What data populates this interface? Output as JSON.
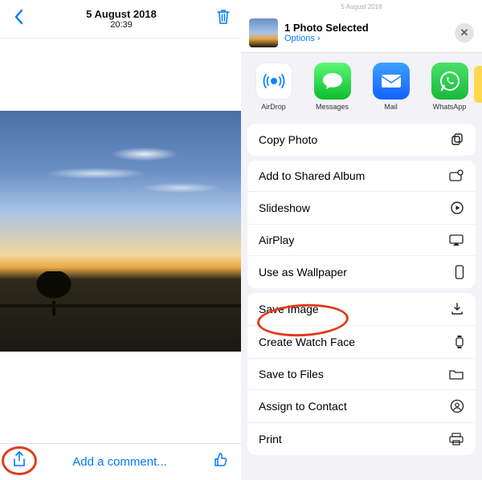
{
  "left": {
    "date": "5 August 2018",
    "time": "20:39",
    "comment_placeholder": "Add a comment..."
  },
  "right": {
    "bg_date": "5 August 2018",
    "header_title": "1 Photo Selected",
    "header_options": "Options",
    "apps": [
      {
        "label": "AirDrop"
      },
      {
        "label": "Messages"
      },
      {
        "label": "Mail"
      },
      {
        "label": "WhatsApp"
      }
    ],
    "group1": [
      {
        "label": "Copy Photo"
      }
    ],
    "group2": [
      {
        "label": "Add to Shared Album"
      },
      {
        "label": "Slideshow"
      },
      {
        "label": "AirPlay"
      },
      {
        "label": "Use as Wallpaper"
      }
    ],
    "group3": [
      {
        "label": "Save Image"
      },
      {
        "label": "Create Watch Face"
      },
      {
        "label": "Save to Files"
      },
      {
        "label": "Assign to Contact"
      },
      {
        "label": "Print"
      }
    ]
  }
}
